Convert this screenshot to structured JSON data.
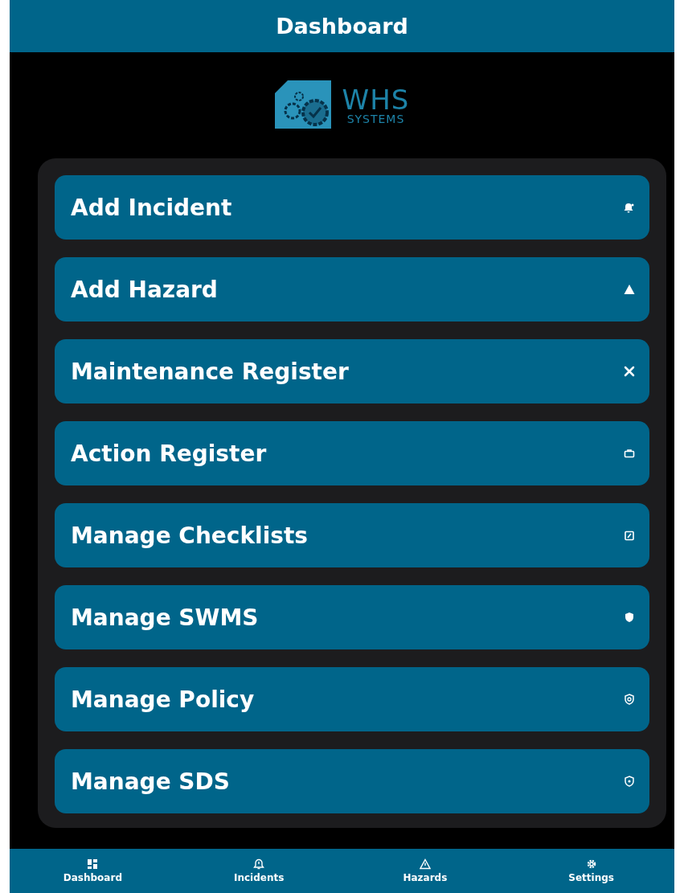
{
  "header": {
    "title": "Dashboard"
  },
  "logo": {
    "name": "WHS",
    "subtitle": "SYSTEMS"
  },
  "menu": [
    {
      "label": "Add Incident"
    },
    {
      "label": "Add Hazard"
    },
    {
      "label": "Maintenance Register"
    },
    {
      "label": "Action Register"
    },
    {
      "label": "Manage Checklists"
    },
    {
      "label": "Manage SWMS"
    },
    {
      "label": "Manage Policy"
    },
    {
      "label": "Manage SDS"
    }
  ],
  "tab_bar": [
    {
      "label": "Dashboard"
    },
    {
      "label": "Incidents"
    },
    {
      "label": "Hazards"
    },
    {
      "label": "Settings"
    }
  ]
}
